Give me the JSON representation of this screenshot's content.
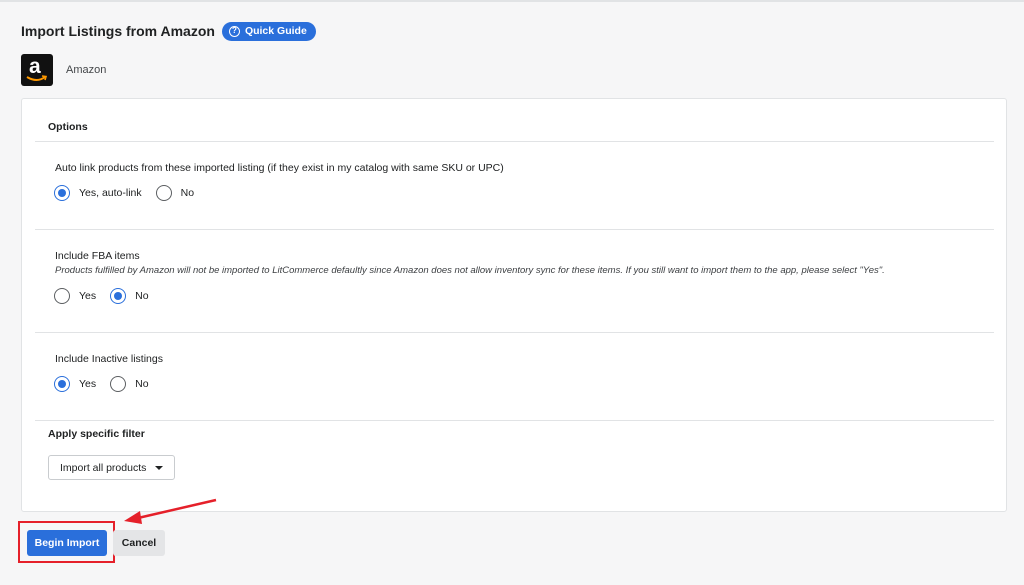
{
  "header": {
    "title": "Import Listings from Amazon",
    "guide_label": "Quick Guide",
    "guide_icon": "question-circle-icon"
  },
  "store": {
    "logo_letter": "a",
    "name": "Amazon"
  },
  "options": {
    "title": "Options",
    "auto_link": {
      "label": "Auto link products from these imported listing (if they exist in my catalog with same SKU or UPC)",
      "options": [
        "Yes, auto-link",
        "No"
      ],
      "selected": "Yes, auto-link"
    },
    "fba": {
      "label": "Include FBA items",
      "description": "Products fulfilled by Amazon will not be imported to LitCommerce defaultly since Amazon does not allow inventory sync for these items. If you still want to import them to the app, please select \"Yes\".",
      "options": [
        "Yes",
        "No"
      ],
      "selected": "No"
    },
    "inactive": {
      "label": "Include Inactive listings",
      "options": [
        "Yes",
        "No"
      ],
      "selected": "Yes"
    }
  },
  "filter": {
    "title": "Apply specific filter",
    "selected": "Import all products"
  },
  "actions": {
    "begin_label": "Begin Import",
    "cancel_label": "Cancel"
  },
  "colors": {
    "primary": "#2a6fdb",
    "annotation": "#e5202a"
  }
}
